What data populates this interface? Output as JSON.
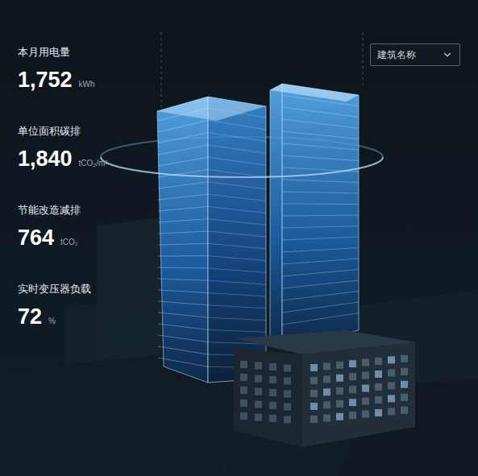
{
  "building_select": {
    "placeholder": "建筑名称"
  },
  "metrics": [
    {
      "label": "本月用电量",
      "value": "1,752",
      "unit": "kWh"
    },
    {
      "label": "单位面积碳排",
      "value": "1,840",
      "unit": "tCO₂/m²"
    },
    {
      "label": "节能改造减排",
      "value": "764",
      "unit": "tCO₂"
    },
    {
      "label": "实时变压器负载",
      "value": "72",
      "unit": "%"
    }
  ]
}
